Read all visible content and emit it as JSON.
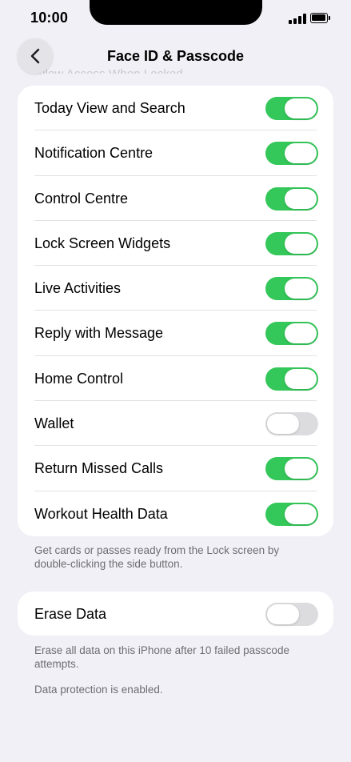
{
  "status_bar": {
    "time": "10:00"
  },
  "nav": {
    "title": "Face ID & Passcode"
  },
  "section_header": "Allow Access When Locked",
  "allow_access_rows": [
    {
      "label": "Today View and Search",
      "on": true
    },
    {
      "label": "Notification Centre",
      "on": true
    },
    {
      "label": "Control Centre",
      "on": true
    },
    {
      "label": "Lock Screen Widgets",
      "on": true
    },
    {
      "label": "Live Activities",
      "on": true
    },
    {
      "label": "Reply with Message",
      "on": true
    },
    {
      "label": "Home Control",
      "on": true
    },
    {
      "label": "Wallet",
      "on": false
    },
    {
      "label": "Return Missed Calls",
      "on": true
    },
    {
      "label": "Workout Health Data",
      "on": true
    }
  ],
  "wallet_footnote": "Get cards or passes ready from the Lock screen by double-clicking the side button.",
  "erase": {
    "label": "Erase Data",
    "on": false
  },
  "erase_footnote": "Erase all data on this iPhone after 10 failed passcode attempts.",
  "protection_note": "Data protection is enabled.",
  "colors": {
    "toggle_on": "#34c759",
    "toggle_off": "#dcdcdf",
    "background": "#f0f0f6"
  }
}
